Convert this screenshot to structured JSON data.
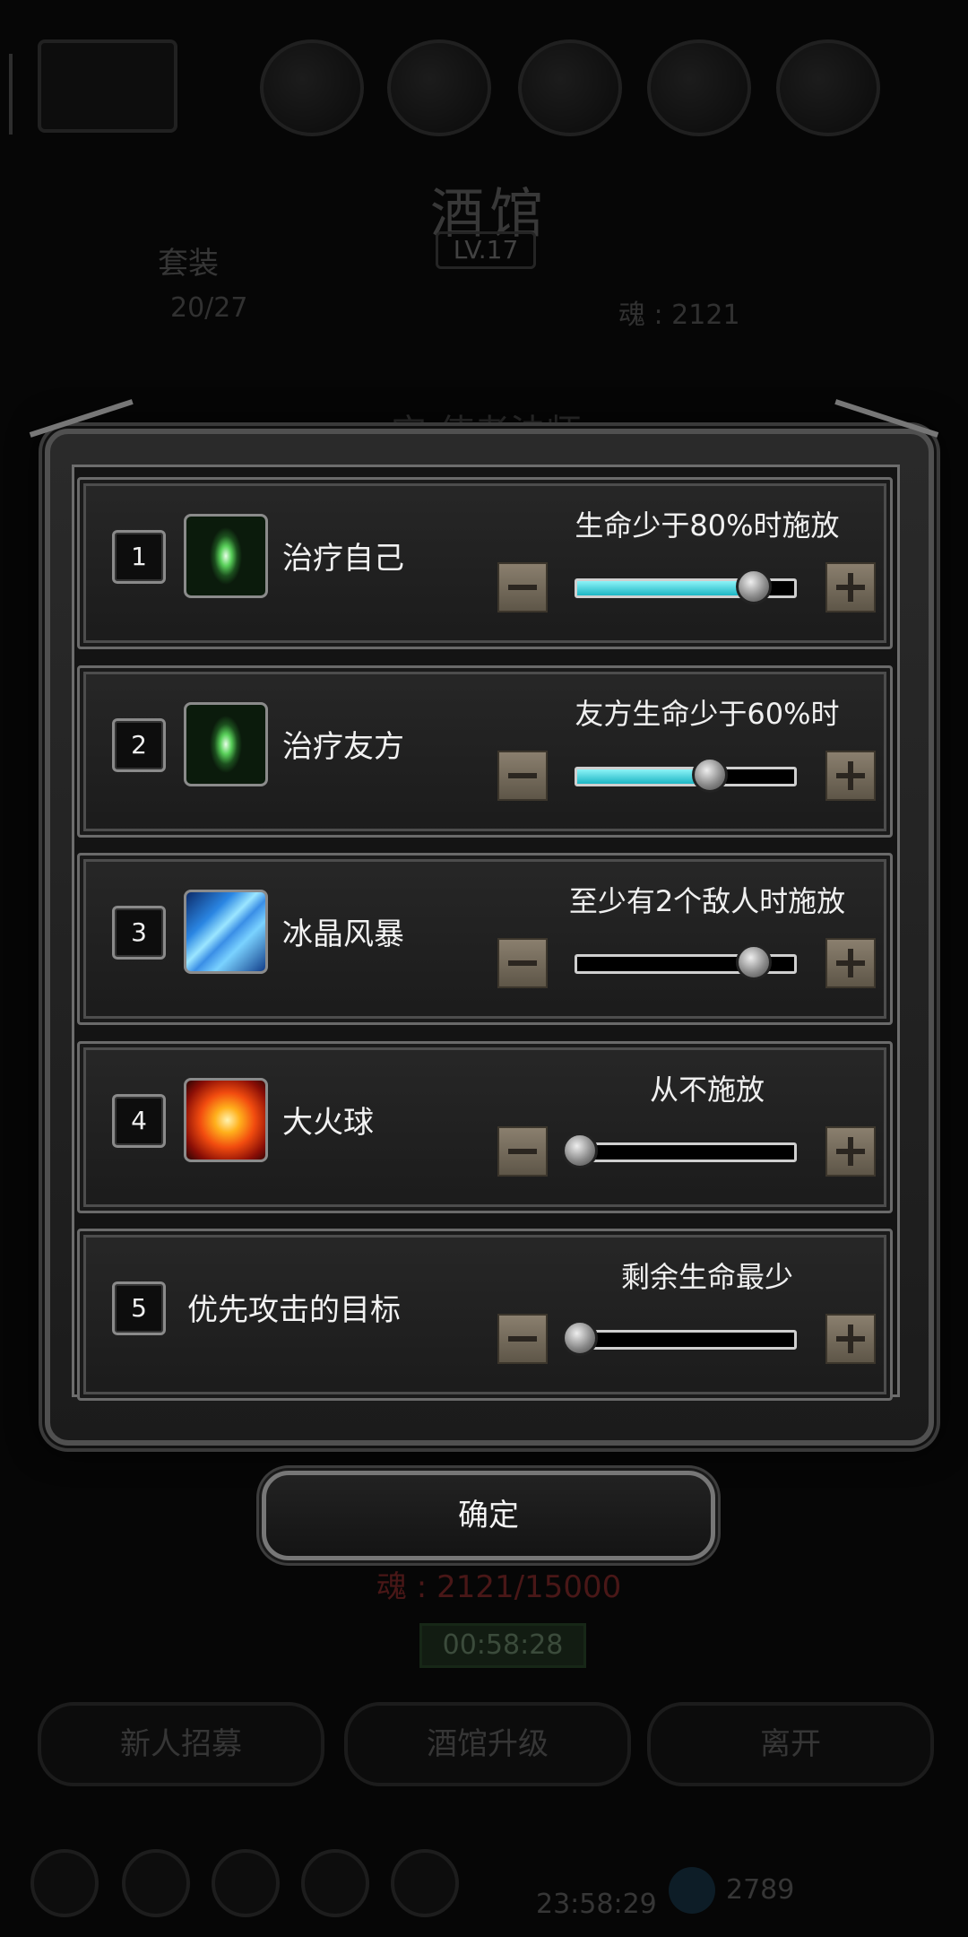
{
  "background": {
    "title": "酒馆",
    "level": "LV.17",
    "tab": "套装",
    "stat_left": "20/27",
    "stat_right": "魂 : 2121",
    "hero_name": "宝 使者法师",
    "soul": "魂 : 2121/15000",
    "timer": "00:58:28",
    "buttons": [
      "新人招募",
      "酒馆升级",
      "离开"
    ],
    "clock": "23:58:29",
    "money": "2789"
  },
  "rows": [
    {
      "index": "1",
      "label": "治疗自己",
      "icon": "heal-icon",
      "condition": "生命少于80%时施放",
      "level": 0.8
    },
    {
      "index": "2",
      "label": "治疗友方",
      "icon": "heal-icon",
      "condition": "友方生命少于60%时",
      "level": 0.6
    },
    {
      "index": "3",
      "label": "冰晶风暴",
      "icon": "ice-storm-icon",
      "condition": "至少有2个敌人时施放",
      "level": 0.8
    },
    {
      "index": "4",
      "label": "大火球",
      "icon": "fireball-icon",
      "condition": "从不施放",
      "level": 0
    },
    {
      "index": "5",
      "label": "优先攻击的目标",
      "icon": "",
      "condition": "剩余生命最少",
      "level": 0
    }
  ],
  "confirm_label": "确定",
  "colors": {
    "slider_fill": "#1cb6c4",
    "dialog_bg": "#1b1b1b"
  }
}
